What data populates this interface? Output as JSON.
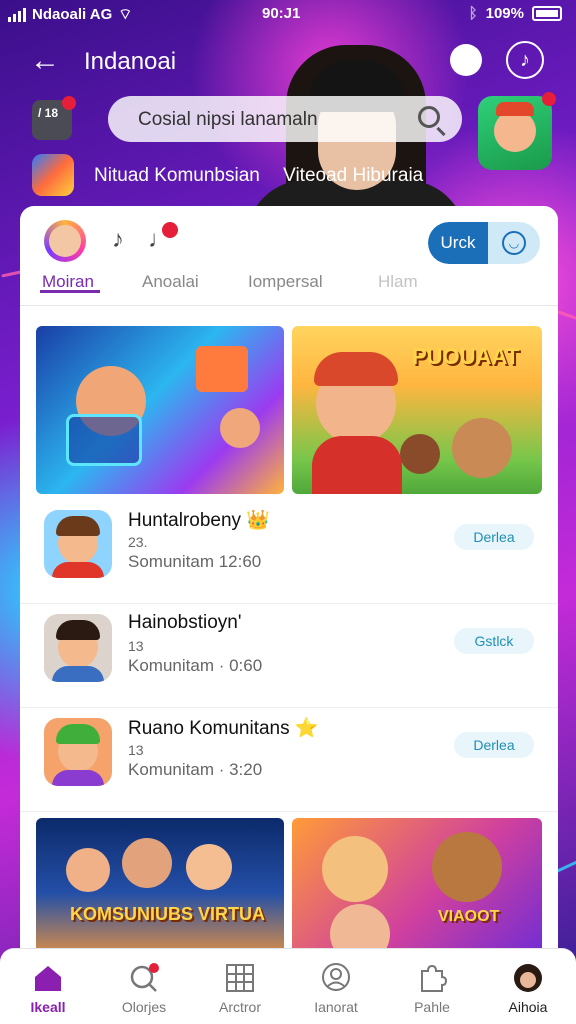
{
  "status": {
    "carrier": "Ndaoali AG",
    "time": "90:J1",
    "battery": "109%"
  },
  "header": {
    "title": "Indanoai",
    "back_icon": "arrow-left-icon"
  },
  "search": {
    "placeholder": "Cosial nipsi lanamaln"
  },
  "mini_box_text": "/ 18",
  "sublabels": [
    "Nituad Komunbsian",
    "Viteoad Hiburaia"
  ],
  "card": {
    "toggle_label": "Urck",
    "tabs": [
      "Moiran",
      "Anoalai",
      "Iompersal",
      "Hlam"
    ],
    "active_tab": 0,
    "tiles": [
      {
        "title": ""
      },
      {
        "title": "PUOUAAT"
      },
      {
        "title": "KOMSUNIUBS VIRTUA"
      },
      {
        "title": "VIAOOT"
      }
    ],
    "rows": [
      {
        "title": "Huntalrobeny",
        "emoji": "👑",
        "count": "23.",
        "meta": "Somunitam 12:60",
        "button": "Derlea"
      },
      {
        "title": "Hainobstioyn'",
        "emoji": "",
        "count": "13",
        "meta": "Komunitam · 0:60",
        "button": "Gstlck"
      },
      {
        "title": "Ruano Komunitans",
        "emoji": "⭐",
        "count": "13",
        "meta": "Komunitam · 3:20",
        "button": "Derlea"
      }
    ]
  },
  "nav": [
    {
      "label": "Ikeall",
      "icon": "home-icon",
      "active": true
    },
    {
      "label": "Olorjes",
      "icon": "search-icon",
      "active": false
    },
    {
      "label": "Arctror",
      "icon": "grid-icon",
      "active": false
    },
    {
      "label": "Ianorat",
      "icon": "profile-icon",
      "active": false
    },
    {
      "label": "Pahle",
      "icon": "puzzle-icon",
      "active": false
    },
    {
      "label": "Aihoia",
      "icon": "avatar-icon",
      "active": false
    }
  ],
  "colors": {
    "accent": "#7b2bb0",
    "primary_blue": "#1b6fb8",
    "badge_red": "#e51e3a"
  }
}
